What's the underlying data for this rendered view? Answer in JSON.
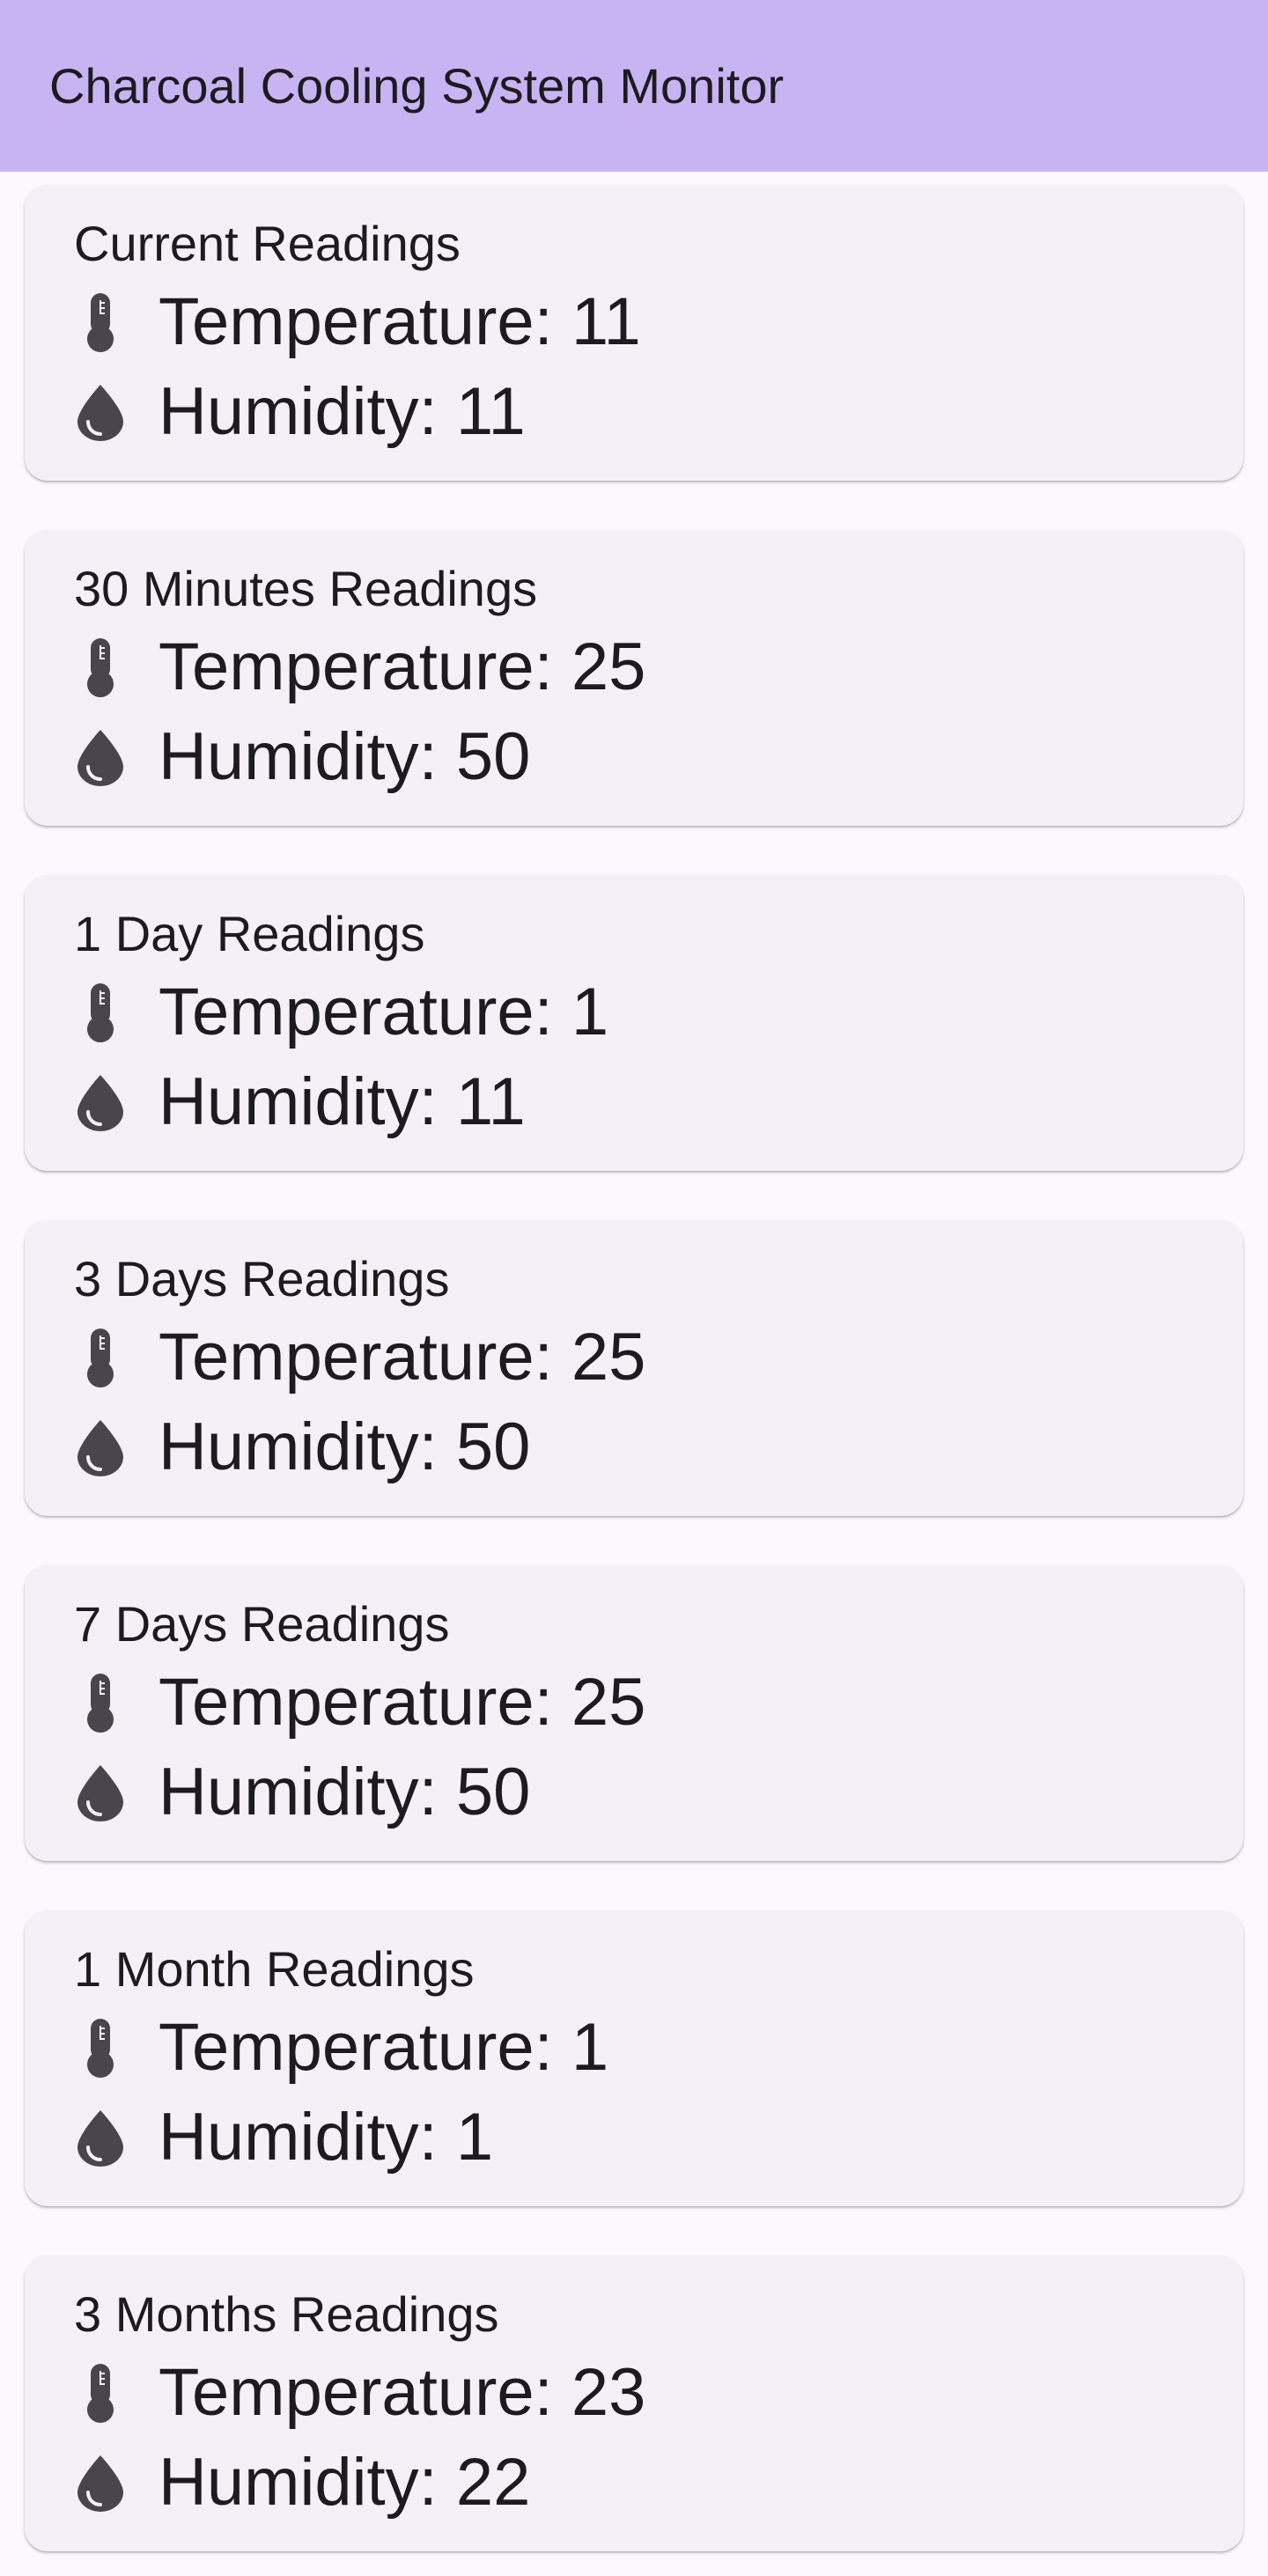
{
  "app": {
    "title": "Charcoal Cooling System Monitor"
  },
  "colors": {
    "app_bar": "#c8b4f3",
    "background": "#fdf7fe",
    "card": "#f5f0f7",
    "text": "#1d1b20",
    "icon": "#49454f"
  },
  "icons": {
    "temperature": "thermometer-icon",
    "humidity": "water-drop-icon"
  },
  "cards": [
    {
      "title": "Current Readings",
      "temperature": "Temperature: 11",
      "humidity": "Humidity: 11"
    },
    {
      "title": "30 Minutes Readings",
      "temperature": "Temperature: 25",
      "humidity": "Humidity: 50"
    },
    {
      "title": "1 Day Readings",
      "temperature": "Temperature: 1",
      "humidity": "Humidity: 11"
    },
    {
      "title": "3 Days Readings",
      "temperature": "Temperature: 25",
      "humidity": "Humidity: 50"
    },
    {
      "title": "7 Days Readings",
      "temperature": "Temperature: 25",
      "humidity": "Humidity: 50"
    },
    {
      "title": "1 Month Readings",
      "temperature": "Temperature: 1",
      "humidity": "Humidity: 1"
    },
    {
      "title": "3 Months Readings",
      "temperature": "Temperature: 23",
      "humidity": "Humidity: 22"
    }
  ]
}
